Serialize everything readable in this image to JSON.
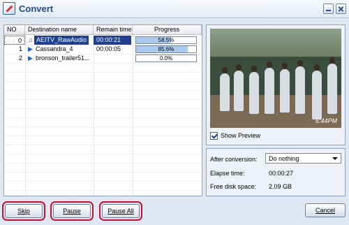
{
  "window": {
    "title": "Convert",
    "icon": "converter-app-icon"
  },
  "table": {
    "columns": [
      "NO",
      "Destination name",
      "Remain time",
      "Progress"
    ],
    "rows": [
      {
        "no": "0",
        "name": "AEITV_RawAudio",
        "remain": "00:00:21",
        "progress_label": "58.5%",
        "progress": 58.5,
        "icon": "audio-file-icon",
        "selected": true
      },
      {
        "no": "1",
        "name": "Cassandra_4",
        "remain": "00:00:05",
        "progress_label": "85.6%",
        "progress": 85.6,
        "icon": "video-file-icon",
        "selected": false
      },
      {
        "no": "2",
        "name": "bronson_trailer51...",
        "remain": "",
        "progress_label": "0.0%",
        "progress": 0,
        "icon": "video-file-icon",
        "selected": false
      }
    ]
  },
  "preview": {
    "timestamp": "6:44PM",
    "show_preview_label": "Show Preview",
    "show_preview_checked": true
  },
  "info": {
    "after_label": "After conversion:",
    "after_value": "Do nothing",
    "elapse_label": "Elapse time:",
    "elapse_value": "00:00:27",
    "disk_label": "Free disk space:",
    "disk_value": "2.09 GB"
  },
  "buttons": {
    "skip": "Skip",
    "pause": "Pause",
    "pause_all": "Pause All",
    "cancel": "Cancel"
  }
}
